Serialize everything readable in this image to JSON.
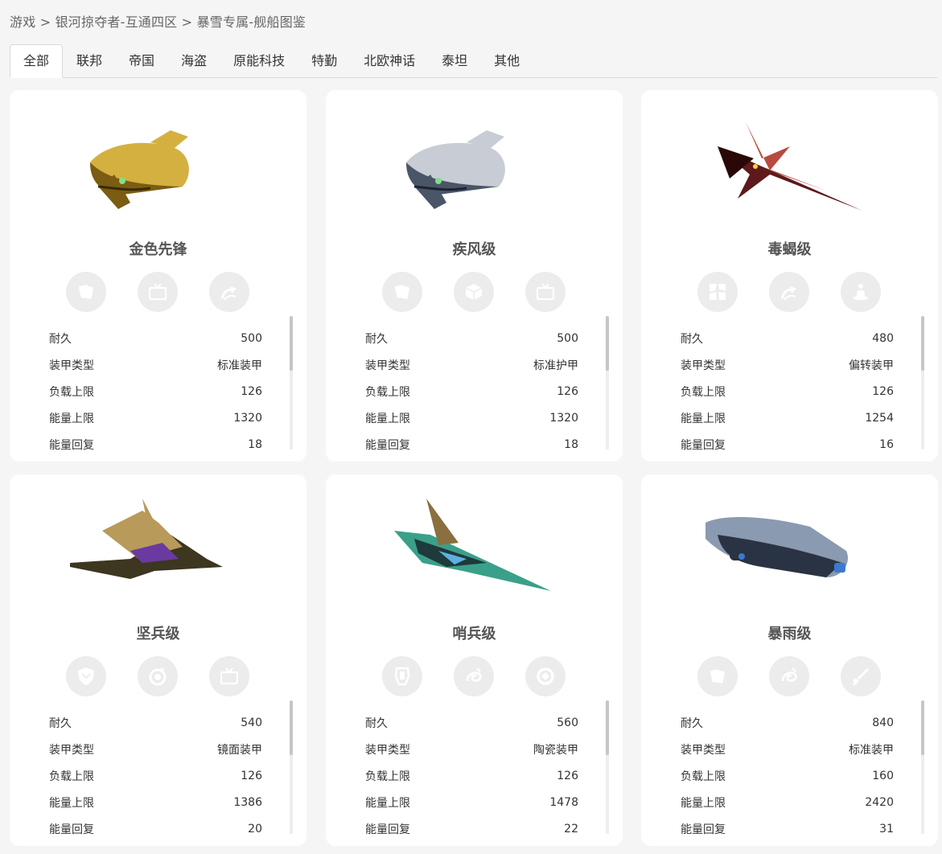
{
  "breadcrumb": [
    "游戏",
    "银河掠夺者-互通四区",
    "暴雪专属-舰船图鉴"
  ],
  "breadcrumb_sep": " > ",
  "tabs": [
    "全部",
    "联邦",
    "帝国",
    "海盗",
    "原能科技",
    "特勤",
    "北欧神话",
    "泰坦",
    "其他"
  ],
  "active_tab": "全部",
  "stat_labels": [
    "耐久",
    "装甲类型",
    "负载上限",
    "能量上限",
    "能量回复"
  ],
  "ships": [
    {
      "name": "金色先锋",
      "skills": [
        "cards-icon",
        "tv-icon",
        "swirl-arrow-icon"
      ],
      "stats": [
        "500",
        "标准装甲",
        "126",
        "1320",
        "18"
      ],
      "palette": [
        "#7a5c12",
        "#d4b040",
        "#3a2a08"
      ]
    },
    {
      "name": "疾风级",
      "skills": [
        "cards-icon",
        "cube-icon",
        "tv-icon"
      ],
      "stats": [
        "500",
        "标准护甲",
        "126",
        "1320",
        "18"
      ],
      "palette": [
        "#4a5568",
        "#c8ccd4",
        "#1d2330"
      ]
    },
    {
      "name": "毒蝎级",
      "skills": [
        "shatter-icon",
        "swirl-arrow-icon",
        "figure-icon"
      ],
      "stats": [
        "480",
        "偏转装甲",
        "126",
        "1254",
        "16"
      ],
      "palette": [
        "#5e1a1a",
        "#b84a40",
        "#2a0808"
      ]
    },
    {
      "name": "坚兵级",
      "skills": [
        "shield-icon",
        "target-icon",
        "tv-icon"
      ],
      "stats": [
        "540",
        "镜面装甲",
        "126",
        "1386",
        "20"
      ],
      "palette": [
        "#3d3620",
        "#b89a5a",
        "#6a3aa0"
      ]
    },
    {
      "name": "哨兵级",
      "skills": [
        "armor-icon",
        "swirl-icon",
        "ring-icon"
      ],
      "stats": [
        "560",
        "陶瓷装甲",
        "126",
        "1478",
        "22"
      ],
      "palette": [
        "#1e3a3a",
        "#3aa08a",
        "#8a7040"
      ]
    },
    {
      "name": "暴雨级",
      "skills": [
        "cards-icon",
        "swirl-icon",
        "sword-icon"
      ],
      "stats": [
        "840",
        "标准装甲",
        "160",
        "2420",
        "31"
      ],
      "palette": [
        "#2a3344",
        "#8a9ab0",
        "#3a7ad0"
      ]
    }
  ]
}
